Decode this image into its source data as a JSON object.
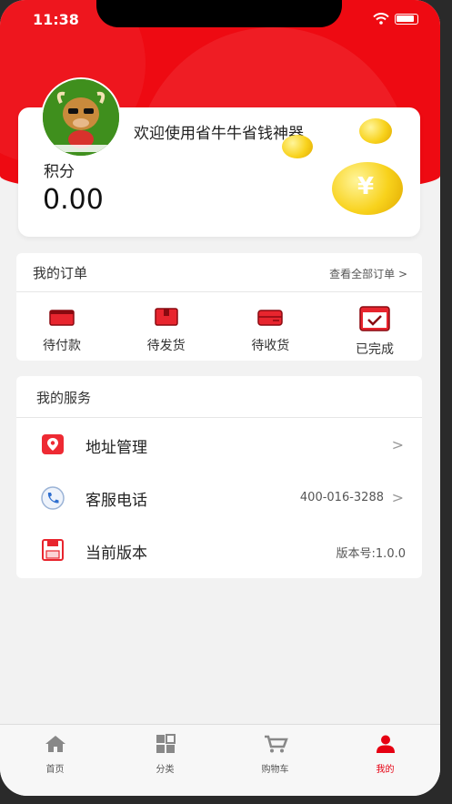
{
  "status": {
    "time": "11:38"
  },
  "profile": {
    "welcome": "欢迎使用省牛牛省钱神器",
    "points_label": "积分",
    "points_value": "0.00"
  },
  "orders": {
    "title": "我的订单",
    "view_all": "查看全部订单 >",
    "items": [
      {
        "label": "待付款",
        "icon": "wallet-icon"
      },
      {
        "label": "待发货",
        "icon": "package-icon"
      },
      {
        "label": "待收货",
        "icon": "delivery-box-icon"
      },
      {
        "label": "已完成",
        "icon": "calendar-check-icon"
      }
    ]
  },
  "services": {
    "title": "我的服务",
    "items": [
      {
        "label": "地址管理",
        "value": "",
        "icon": "location-pin-icon"
      },
      {
        "label": "客服电话",
        "value": "400-016-3288",
        "icon": "phone-icon"
      },
      {
        "label": "当前版本",
        "value": "版本号:1.0.0",
        "icon": "save-icon"
      }
    ]
  },
  "tabbar": {
    "items": [
      {
        "label": "首页",
        "icon": "home-icon"
      },
      {
        "label": "分类",
        "icon": "grid-icon"
      },
      {
        "label": "购物车",
        "icon": "cart-icon"
      },
      {
        "label": "我的",
        "icon": "user-icon"
      }
    ],
    "active": "我的"
  },
  "colors": {
    "brand": "#e60012",
    "header": "#ee0a12",
    "coin": "#f8d21c"
  }
}
